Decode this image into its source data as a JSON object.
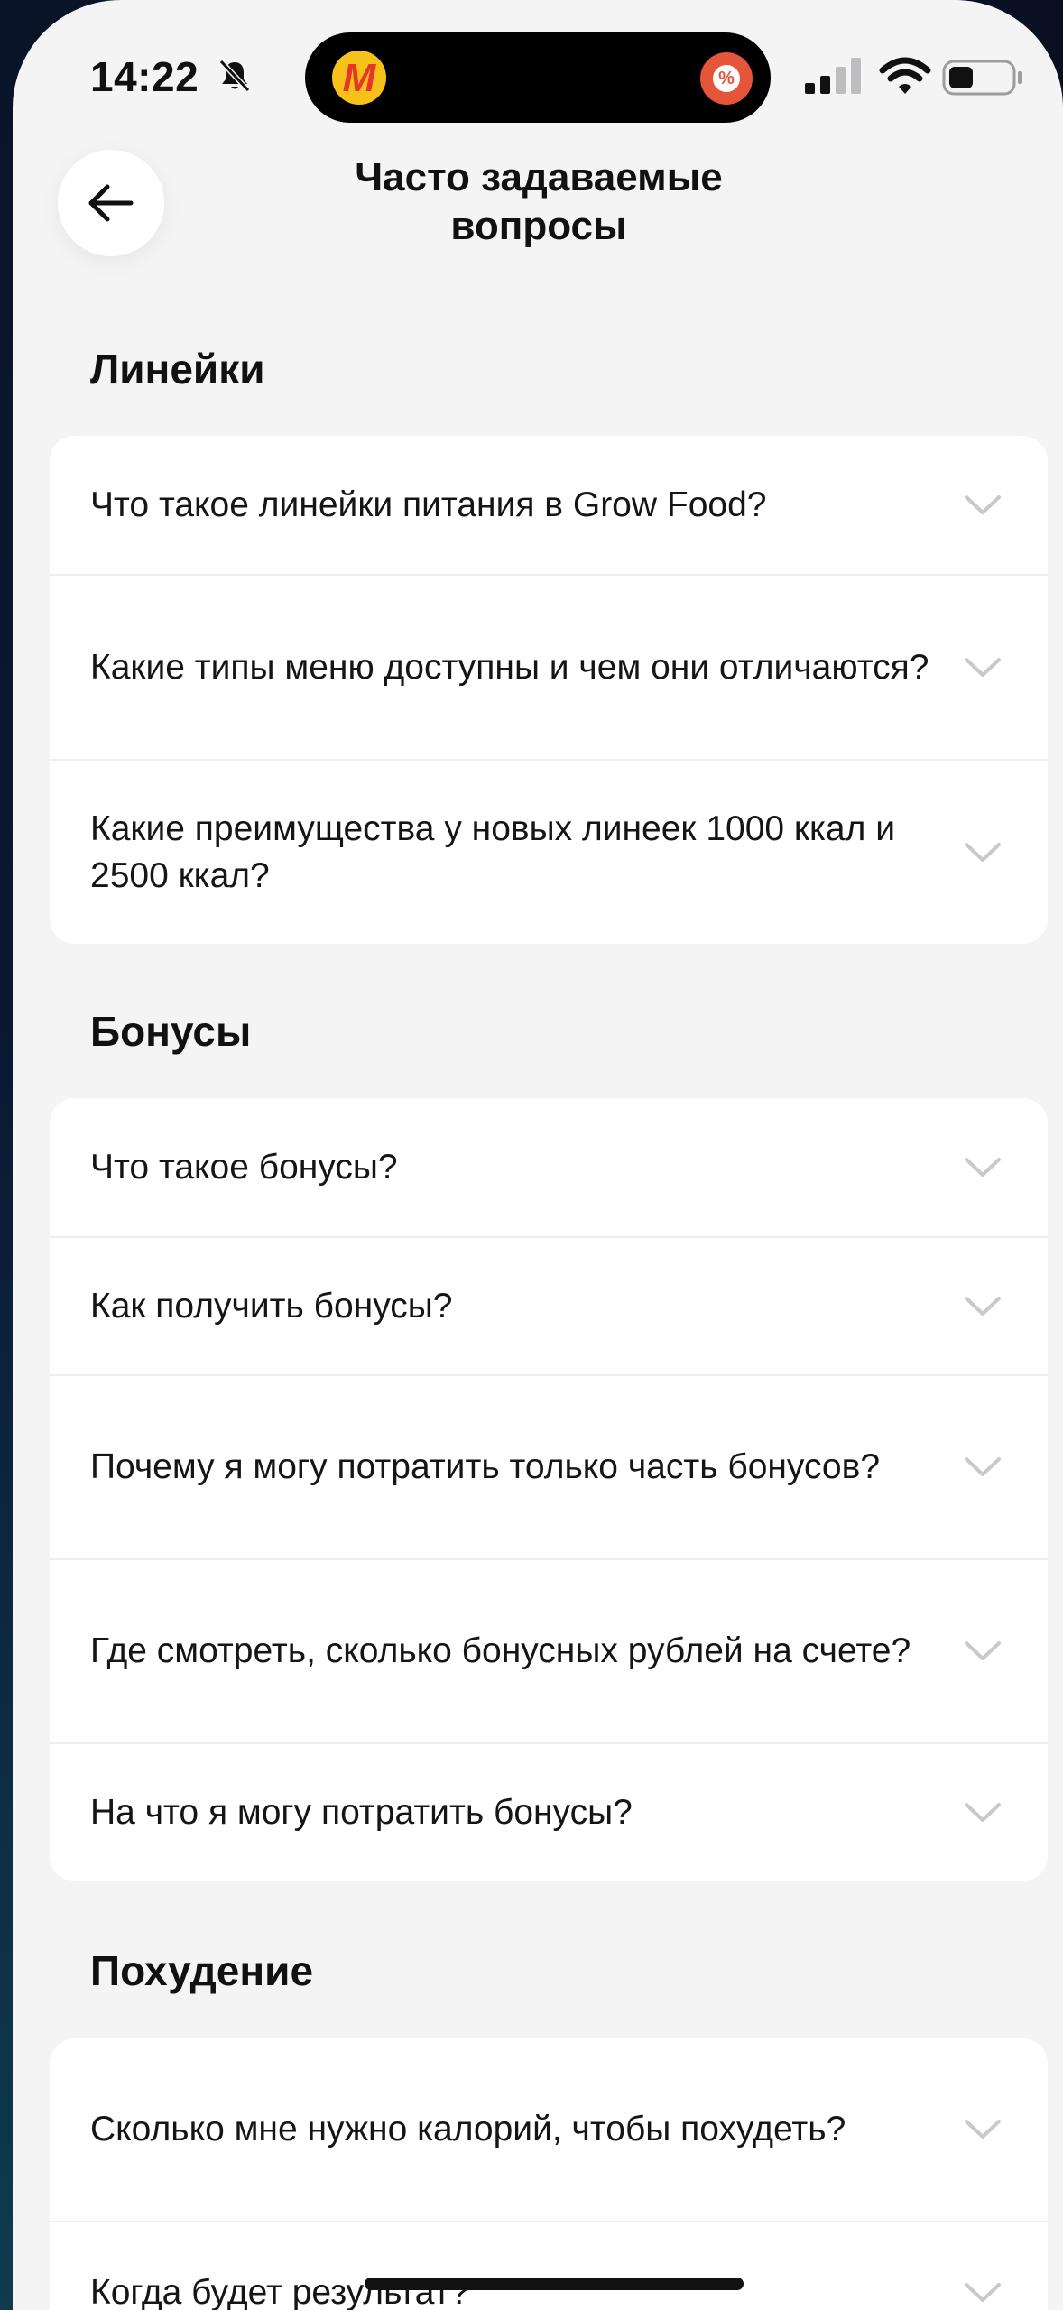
{
  "status_bar": {
    "time": "14:22",
    "island_app_letter": "M",
    "island_badge_symbol": "%"
  },
  "header": {
    "title": "Часто задаваемые вопросы"
  },
  "sections": [
    {
      "title": "Линейки",
      "items": [
        "Что такое линейки питания в Grow Food?",
        "Какие типы меню доступны и чем они отличаются?",
        "Какие преимущества у новых линеек 1000 ккал и 2500 ккал?"
      ]
    },
    {
      "title": "Бонусы",
      "items": [
        "Что такое бонусы?",
        "Как получить бонусы?",
        "Почему я могу потратить только часть бонусов?",
        "Где смотреть, сколько бонусных рублей на счете?",
        "На что я могу потратить бонусы?"
      ]
    },
    {
      "title": "Похудение",
      "items": [
        "Сколько мне нужно калорий, чтобы похудеть?",
        "Когда будет результат?"
      ]
    }
  ],
  "icons": {
    "back": "arrow-left-icon",
    "expand": "chevron-down-icon",
    "silent": "bell-slash-icon"
  }
}
